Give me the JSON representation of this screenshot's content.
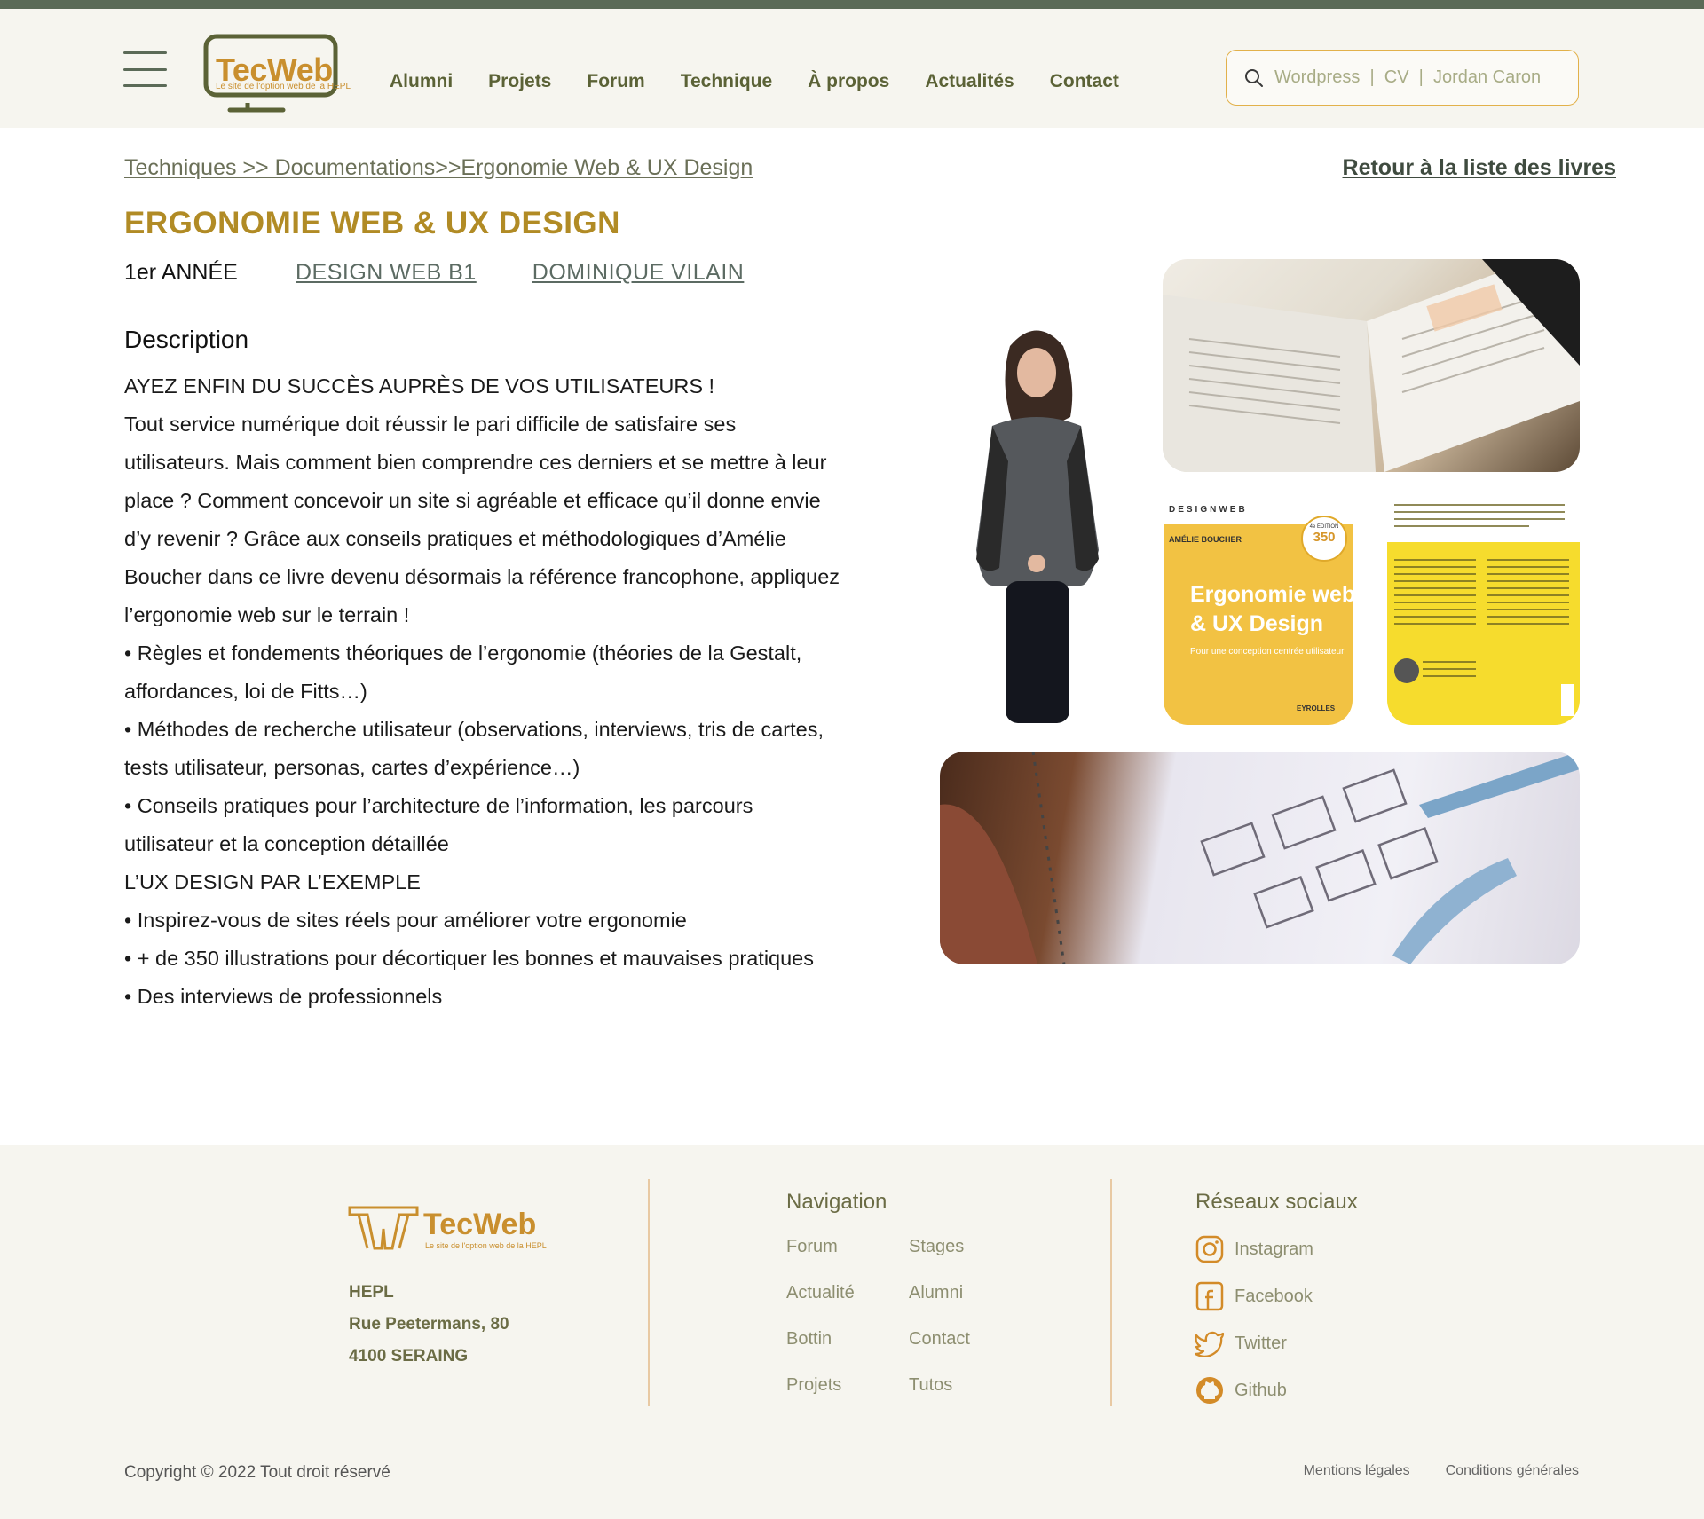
{
  "header": {
    "logo_name": "TecWeb",
    "logo_tagline": "Le site de l'option web de la HEPL",
    "nav": [
      "Alumni",
      "Projets",
      "Forum",
      "Technique",
      "À propos",
      "Actualités",
      "Contact"
    ],
    "search_placeholder": "Wordpress  |  CV  |  Jordan Caron"
  },
  "page": {
    "breadcrumb": "Techniques >> Documentations>>Ergonomie Web & UX Design",
    "back_link": "Retour à la liste des livres",
    "title": "ERGONOMIE WEB & UX DESIGN",
    "year": "1er ANNÉE",
    "course": "DESIGN WEB B1",
    "teacher": "DOMINIQUE VILAIN",
    "description_heading": "Description",
    "description_lines": [
      "AYEZ ENFIN DU SUCCÈS AUPRÈS DE VOS UTILISATEURS !",
      "Tout service numérique doit réussir le pari difficile de satisfaire ses",
      "utilisateurs. Mais comment bien comprendre ces derniers et se mettre à leur",
      "place ? Comment concevoir un site si agréable et efficace qu’il donne envie",
      "d’y revenir ? Grâce aux conseils pratiques et méthodologiques d’Amélie",
      "Boucher dans ce livre devenu désormais la référence francophone, appliquez",
      "l’ergonomie web sur le terrain !",
      "• Règles et fondements théoriques de l’ergonomie (théories de la Gestalt,",
      "affordances, loi de Fitts…)",
      "• Méthodes de recherche utilisateur (observations, interviews, tris de cartes,",
      "tests utilisateur, personas, cartes d’expérience…)",
      "• Conseils pratiques pour l’architecture de l’information, les parcours",
      "utilisateur et la conception détaillée",
      "L’UX DESIGN PAR L’EXEMPLE",
      "• Inspirez-vous de sites réels pour améliorer votre ergonomie",
      "• + de 350 illustrations pour décortiquer les bonnes et mauvaises pratiques",
      "• Des interviews de professionnels"
    ]
  },
  "book_cover": {
    "series": "DESIGNWEB",
    "author": "AMÉLIE BOUCHER",
    "title_line1": "Ergonomie web",
    "title_line2": "& UX Design",
    "subtitle": "Pour une conception centrée utilisateur",
    "badge_number": "350",
    "badge_edition": "4e ÉDITION",
    "publisher": "EYROLLES"
  },
  "footer": {
    "logo_name": "TecWeb",
    "logo_tagline": "Le site de l'option web de la HEPL",
    "address": [
      "HEPL",
      "Rue Peetermans, 80",
      "4100 SERAING"
    ],
    "nav_title": "Navigation",
    "nav_links": [
      "Forum",
      "Stages",
      "Actualité",
      "Alumni",
      "Bottin",
      "Contact",
      "Projets",
      "Tutos"
    ],
    "social_title": "Réseaux sociaux",
    "social_links": [
      "Instagram",
      "Facebook",
      "Twitter",
      "Github"
    ],
    "copyright": "Copyright © 2022 Tout droit réservé",
    "legal": [
      "Mentions légales",
      "Conditions générales"
    ]
  },
  "colors": {
    "accent": "#b18b25",
    "brand_orange": "#c98f2e",
    "olive": "#5b6236",
    "topbar": "#5b6a57",
    "footer_bg": "#f6f5ef"
  }
}
